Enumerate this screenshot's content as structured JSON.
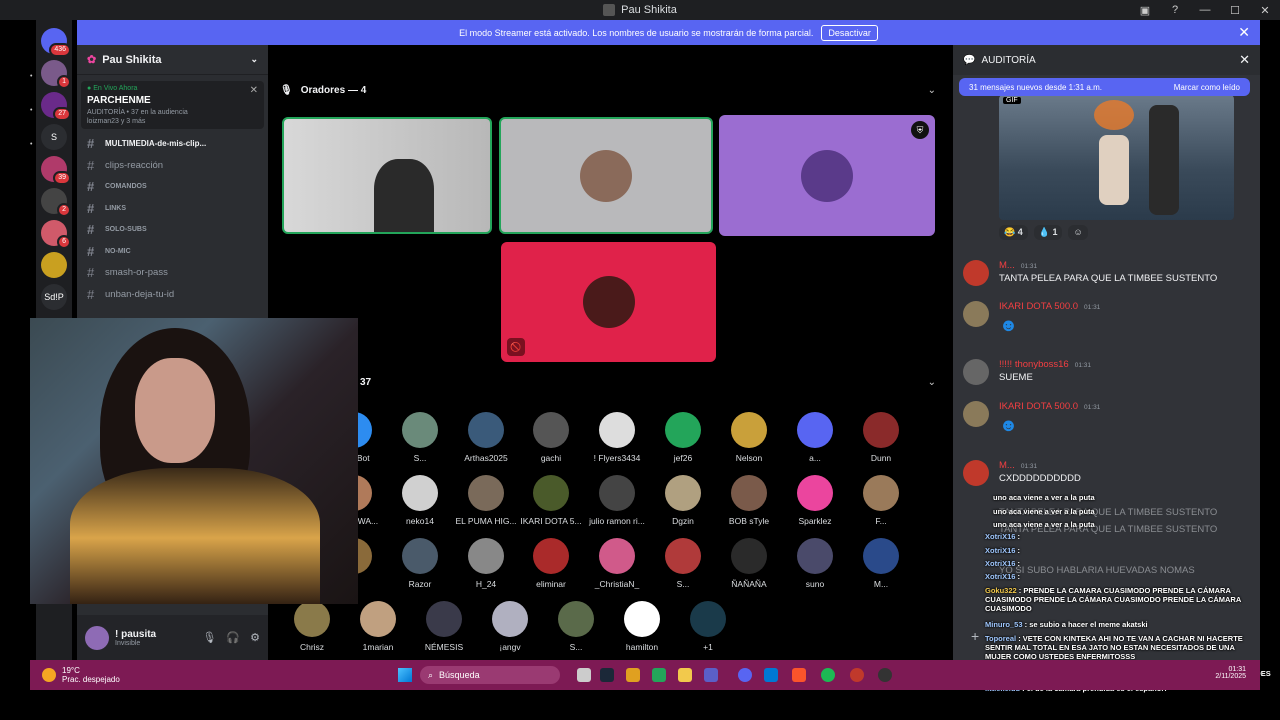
{
  "window": {
    "title": "Pau Shikita"
  },
  "banner": {
    "text": "El modo Streamer está activado. Los nombres de usuario se mostrarán de forma parcial.",
    "button": "Desactivar"
  },
  "guilds": [
    {
      "label": "",
      "badge": "436"
    },
    {
      "label": "",
      "badge": "1"
    },
    {
      "label": "",
      "badge": "27"
    },
    {
      "label": "S",
      "badge": ""
    },
    {
      "label": "",
      "badge": "39"
    },
    {
      "label": "",
      "badge": "2"
    },
    {
      "label": "",
      "badge": "6"
    },
    {
      "label": "",
      "badge": ""
    },
    {
      "label": "Sd!P",
      "badge": ""
    }
  ],
  "sidebar": {
    "server_name": "Pau Shikita",
    "live": {
      "status": "En Vivo Ahora",
      "title": "PARCHENME",
      "meta": "AUDITORÍA • 37 en la audiencia",
      "user": "loizman23 y 3 más"
    },
    "channels": [
      {
        "name": "MULTIMEDIA-de-mis-clip...",
        "style": "bold"
      },
      {
        "name": "clips-reacción",
        "style": "normal"
      },
      {
        "name": "COMANDOS",
        "style": "small"
      },
      {
        "name": "LINKS",
        "style": "small"
      },
      {
        "name": "SOLO-SUBS",
        "style": "small"
      },
      {
        "name": "NO-MIC",
        "style": "small"
      },
      {
        "name": "smash-or-pass",
        "style": "normal"
      },
      {
        "name": "unban-deja-tu-id",
        "style": "normal"
      }
    ],
    "user": {
      "name": "! pausita",
      "status": "Invisible"
    }
  },
  "stage": {
    "speakers_header": "Oradores — 4",
    "audience_count": "37",
    "audience": [
      {
        "name": "TTS Bot",
        "color": "#2d8cf0"
      },
      {
        "name": "S...",
        "color": "#6a8a7a"
      },
      {
        "name": "Arthas2025",
        "color": "#3a5a7a"
      },
      {
        "name": "gachi",
        "color": "#555555"
      },
      {
        "name": "! Flyers3434",
        "color": "#dddddd"
      },
      {
        "name": "jef26",
        "color": "#23a55a"
      },
      {
        "name": "Nelson",
        "color": "#c9a03a"
      },
      {
        "name": "a...",
        "color": "#5865f2"
      },
      {
        "name": "Dunn",
        "color": "#8a2a2a"
      },
      {
        "name": "WA... AWA...",
        "color": "#b07a5a"
      },
      {
        "name": "neko14",
        "color": "#d0d0d0"
      },
      {
        "name": "EL PUMA HIG...",
        "color": "#7a6a5a"
      },
      {
        "name": "IKARI DOTA 5...",
        "color": "#4a5a2a"
      },
      {
        "name": "julio ramon ri...",
        "color": "#444444"
      },
      {
        "name": "Dgzin",
        "color": "#b0a080"
      },
      {
        "name": "BOB sTyle",
        "color": "#7a5a4a"
      },
      {
        "name": "Sparklez",
        "color": "#eb459e"
      },
      {
        "name": "F...",
        "color": "#9a7a5a"
      },
      {
        "name": "...",
        "color": "#8a6a3a"
      },
      {
        "name": "Razor",
        "color": "#4a5a6a"
      },
      {
        "name": "H_24",
        "color": "#888888"
      },
      {
        "name": "eliminar",
        "color": "#aa2a2a"
      },
      {
        "name": "_ChristiaN_",
        "color": "#d05a8a"
      },
      {
        "name": "S...",
        "color": "#b03a3a"
      },
      {
        "name": "ÑAÑAÑA",
        "color": "#2a2a2a"
      },
      {
        "name": "suno",
        "color": "#4a4a6a"
      },
      {
        "name": "M...",
        "color": "#2a4a8a"
      },
      {
        "name": "Chrisz",
        "color": "#8a7a4a"
      },
      {
        "name": "1marian",
        "color": "#c0a080"
      },
      {
        "name": "NÉMESIS",
        "color": "#3a3a4a"
      },
      {
        "name": "¡angv",
        "color": "#b0b0c0"
      },
      {
        "name": "S...",
        "color": "#5a6a4a"
      },
      {
        "name": "hamilton",
        "color": "#ffffff"
      },
      {
        "name": "+1",
        "color": "#1a3a4a"
      }
    ]
  },
  "right": {
    "header": "AUDITORÍA",
    "new_messages": "31 mensajes nuevos desde 1:31 a.m.",
    "mark_read": "Marcar como leído",
    "gif_tag": "GIF",
    "reactions": [
      "4",
      "1"
    ],
    "messages": [
      {
        "user": "M...",
        "time": "01:31",
        "text": "TANTA PELEA PARA QUE LA TIMBEE SUSTENTO",
        "color": "#c0392b"
      },
      {
        "user": "IKARI DOTA 500.0",
        "time": "01:31",
        "text": "",
        "color": "#8a7a5a"
      },
      {
        "user": "!!!!! thonyboss16",
        "time": "01:31",
        "text": "SUEME",
        "color": "#666666"
      },
      {
        "user": "IKARI DOTA 500.0",
        "time": "01:31",
        "text": "",
        "color": "#8a7a5a"
      },
      {
        "user": "M...",
        "time": "01:31",
        "text": "CXDDDDDDDDDD",
        "color": "#c0392b"
      }
    ],
    "overlay_chat": [
      {
        "user": "",
        "text": "uno aca viene a ver a la puta"
      },
      {
        "user": "",
        "text": "uno aca viene a ver a la puta"
      },
      {
        "user": "",
        "text": "uno aca viene a ver a la puta"
      },
      {
        "user": "XotriX16",
        "text": ":"
      },
      {
        "user": "XotriX16",
        "text": ":"
      },
      {
        "user": "XotriX16",
        "text": ":"
      },
      {
        "user": "XotriX16",
        "text": ":"
      },
      {
        "user": "Goku322",
        "text": ": PRENDE LA CAMARA CUASIMODO PRENDE LA CÁMARA CUASIMODO PRENDE LA CÁMARA CUASIMODO PRENDE LA CÁMARA CUASIMODO"
      },
      {
        "user": "Minuro_53",
        "text": ": se subio a hacer el meme akatski"
      },
      {
        "user": "Toporeal",
        "text": ": VETE CON KINTEKA AHI NO TE VAN A CACHAR NI HACERTE SENTIR MAL TOTAL EN ESA JATO NO ESTAN NECESITADOS DE UNA MUJER COMO USTEDES ENFERMITOSSS"
      },
      {
        "user": "Napoleonee",
        "text": ": PRENDAN CAMARA COBARDES PRENDAN CAMARA COBARDES"
      },
      {
        "user": "littlekeluu",
        "text": ": el de la camara prendida es el español?"
      }
    ],
    "ghost_lines": [
      "TANTA PELEA PARA QUE LA TIMBEE SUSTENTO",
      "TANTA PELEA PARA QUE LA TIMBEE SUSTENTO",
      "YO SI SUBO HABLARIA HUEVADAS NOMAS"
    ]
  },
  "taskbar": {
    "temp": "19°C",
    "weather": "Prac. despejado",
    "search": "Búsqueda",
    "time": "01:31",
    "date": "2/11/2025"
  }
}
